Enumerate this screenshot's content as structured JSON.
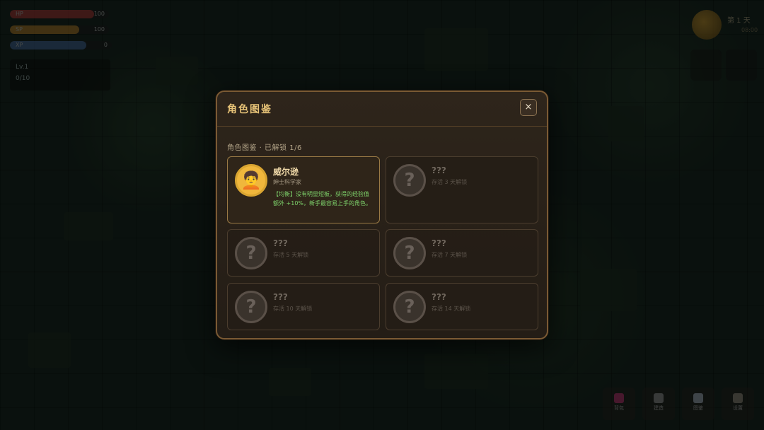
{
  "hud": {
    "bars": [
      {
        "label": "HP",
        "value": "100",
        "color": "#c03a3a",
        "fill": 0.85
      },
      {
        "label": "SP",
        "value": "100",
        "color": "#c98a2b",
        "fill": 0.7
      },
      {
        "label": "XP",
        "value": "0",
        "color": "#4a6fa8",
        "fill": 0.75
      }
    ],
    "status_lines": [
      "Lv.1",
      "0/10"
    ],
    "day_label": "第 1 天",
    "day_sub": "08:00",
    "bottom_buttons": [
      "背包",
      "建造",
      "图鉴",
      "设置"
    ]
  },
  "modal": {
    "title": "角色图鉴",
    "close_icon": "×",
    "subheading": "角色图鉴 · 已解锁 1/6",
    "characters": [
      {
        "name": "威尔逊",
        "subtitle": "绅士科学家",
        "description": "【均衡】没有明显短板，获得的经验值额外 +10%，新手最容易上手的角色。",
        "unlocked": true,
        "avatar": "🧑‍🦱",
        "avatar_icon": "scientist-portrait-icon"
      },
      {
        "name": "???",
        "subtitle": "存活 3 天解锁",
        "unlocked": false,
        "avatar": "?",
        "avatar_icon": "locked-question-icon"
      },
      {
        "name": "???",
        "subtitle": "存活 5 天解锁",
        "unlocked": false,
        "avatar": "?",
        "avatar_icon": "locked-question-icon"
      },
      {
        "name": "???",
        "subtitle": "存活 7 天解锁",
        "unlocked": false,
        "avatar": "?",
        "avatar_icon": "locked-question-icon"
      },
      {
        "name": "???",
        "subtitle": "存活 10 天解锁",
        "unlocked": false,
        "avatar": "?",
        "avatar_icon": "locked-question-icon"
      },
      {
        "name": "???",
        "subtitle": "存活 14 天解锁",
        "unlocked": false,
        "avatar": "?",
        "avatar_icon": "locked-question-icon"
      }
    ]
  },
  "colors": {
    "accent_gold": "#e6c277",
    "unlocked_border": "#9a7a45",
    "description_green": "#7ed36b"
  }
}
